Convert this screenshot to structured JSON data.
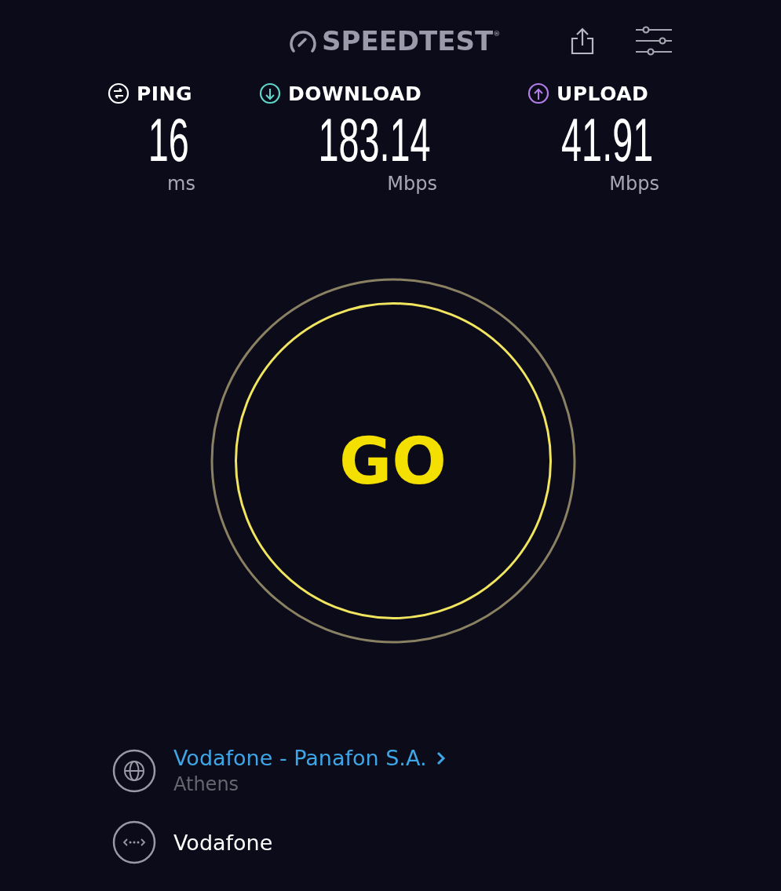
{
  "header": {
    "logo": "SPEEDTEST$^{®}$"
  },
  "metrics": [
    {
      "kind": "ping",
      "label": "PING",
      "value": "16",
      "unit": "ms"
    },
    {
      "kind": "download",
      "label": "DOWNLOAD",
      "value": "183.14",
      "unit": "Mbps"
    },
    {
      "kind": "upload",
      "label": "UPLOAD",
      "value": "41.91",
      "unit": "Mbps"
    }
  ],
  "go_button": {
    "label": "GO"
  },
  "server": {
    "name": "Vodafone - Panafon S.A.",
    "location": "Athens"
  },
  "provider": {
    "name": "Vodafone"
  }
}
